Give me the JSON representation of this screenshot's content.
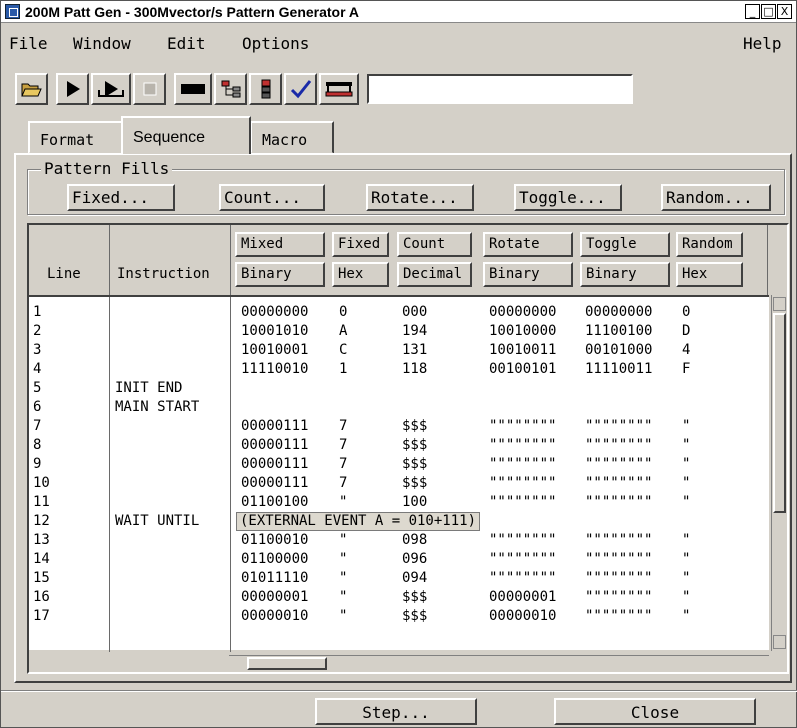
{
  "window": {
    "title": "200M Patt Gen - 300Mvector/s Pattern Generator A",
    "controls": [
      "_",
      "□",
      "X"
    ]
  },
  "menu": {
    "file": "File",
    "window": "Window",
    "edit": "Edit",
    "options": "Options",
    "help": "Help"
  },
  "toolbar": {
    "icons": [
      "open-file-icon",
      "run-icon",
      "run-repetitive-icon",
      "stop-icon",
      "black-bar-icon",
      "format-tree-icon",
      "config-icon",
      "checkmark-icon",
      "cable-icon"
    ],
    "field_value": ""
  },
  "tabs": {
    "format": "Format",
    "sequence": "Sequence",
    "macro": "Macro",
    "active": "sequence"
  },
  "pattern_fills": {
    "legend": "Pattern Fills",
    "buttons": {
      "fixed": "Fixed...",
      "count": "Count...",
      "rotate": "Rotate...",
      "toggle": "Toggle...",
      "random": "Random..."
    }
  },
  "table": {
    "header_line": "Line",
    "header_instruction": "Instruction",
    "columns": [
      {
        "key": "mixed",
        "name": "Mixed",
        "base": "Binary"
      },
      {
        "key": "fixed",
        "name": "Fixed",
        "base": "Hex"
      },
      {
        "key": "count",
        "name": "Count",
        "base": "Decimal"
      },
      {
        "key": "rotate",
        "name": "Rotate",
        "base": "Binary"
      },
      {
        "key": "toggle",
        "name": "Toggle",
        "base": "Binary"
      },
      {
        "key": "random",
        "name": "Random",
        "base": "Hex"
      }
    ],
    "rows": [
      {
        "line": "1",
        "instr": "",
        "mixed": "00000000",
        "fixed": "0",
        "count": "000",
        "rotate": "00000000",
        "toggle": "00000000",
        "random": "0"
      },
      {
        "line": "2",
        "instr": "",
        "mixed": "10001010",
        "fixed": "A",
        "count": "194",
        "rotate": "10010000",
        "toggle": "11100100",
        "random": "D"
      },
      {
        "line": "3",
        "instr": "",
        "mixed": "10010001",
        "fixed": "C",
        "count": "131",
        "rotate": "10010011",
        "toggle": "00101000",
        "random": "4"
      },
      {
        "line": "4",
        "instr": "",
        "mixed": "11110010",
        "fixed": "1",
        "count": "118",
        "rotate": "00100101",
        "toggle": "11110011",
        "random": "F"
      },
      {
        "line": "5",
        "instr": "INIT END",
        "mixed": "",
        "fixed": "",
        "count": "",
        "rotate": "",
        "toggle": "",
        "random": ""
      },
      {
        "line": "6",
        "instr": "MAIN START",
        "mixed": "",
        "fixed": "",
        "count": "",
        "rotate": "",
        "toggle": "",
        "random": ""
      },
      {
        "line": "7",
        "instr": "",
        "mixed": "00000111",
        "fixed": "7",
        "count": "$$$",
        "rotate": "\"\"\"\"\"\"\"\"",
        "toggle": "\"\"\"\"\"\"\"\"",
        "random": "\""
      },
      {
        "line": "8",
        "instr": "",
        "mixed": "00000111",
        "fixed": "7",
        "count": "$$$",
        "rotate": "\"\"\"\"\"\"\"\"",
        "toggle": "\"\"\"\"\"\"\"\"",
        "random": "\""
      },
      {
        "line": "9",
        "instr": "",
        "mixed": "00000111",
        "fixed": "7",
        "count": "$$$",
        "rotate": "\"\"\"\"\"\"\"\"",
        "toggle": "\"\"\"\"\"\"\"\"",
        "random": "\""
      },
      {
        "line": "10",
        "instr": "",
        "mixed": "00000111",
        "fixed": "7",
        "count": "$$$",
        "rotate": "\"\"\"\"\"\"\"\"",
        "toggle": "\"\"\"\"\"\"\"\"",
        "random": "\""
      },
      {
        "line": "11",
        "instr": "",
        "mixed": "01100100",
        "fixed": "\"",
        "count": "100",
        "rotate": "\"\"\"\"\"\"\"\"",
        "toggle": "\"\"\"\"\"\"\"\"",
        "random": "\""
      },
      {
        "line": "12",
        "instr": "WAIT UNTIL",
        "event": "(EXTERNAL EVENT A = 010+111)"
      },
      {
        "line": "13",
        "instr": "",
        "mixed": "01100010",
        "fixed": "\"",
        "count": "098",
        "rotate": "\"\"\"\"\"\"\"\"",
        "toggle": "\"\"\"\"\"\"\"\"",
        "random": "\""
      },
      {
        "line": "14",
        "instr": "",
        "mixed": "01100000",
        "fixed": "\"",
        "count": "096",
        "rotate": "\"\"\"\"\"\"\"\"",
        "toggle": "\"\"\"\"\"\"\"\"",
        "random": "\""
      },
      {
        "line": "15",
        "instr": "",
        "mixed": "01011110",
        "fixed": "\"",
        "count": "094",
        "rotate": "\"\"\"\"\"\"\"\"",
        "toggle": "\"\"\"\"\"\"\"\"",
        "random": "\""
      },
      {
        "line": "16",
        "instr": "",
        "mixed": "00000001",
        "fixed": "\"",
        "count": "$$$",
        "rotate": "00000001",
        "toggle": "\"\"\"\"\"\"\"\"",
        "random": "\""
      },
      {
        "line": "17",
        "instr": "",
        "mixed": "00000010",
        "fixed": "\"",
        "count": "$$$",
        "rotate": "00000010",
        "toggle": "\"\"\"\"\"\"\"\"",
        "random": "\""
      }
    ]
  },
  "footer": {
    "step": "Step...",
    "close": "Close"
  }
}
